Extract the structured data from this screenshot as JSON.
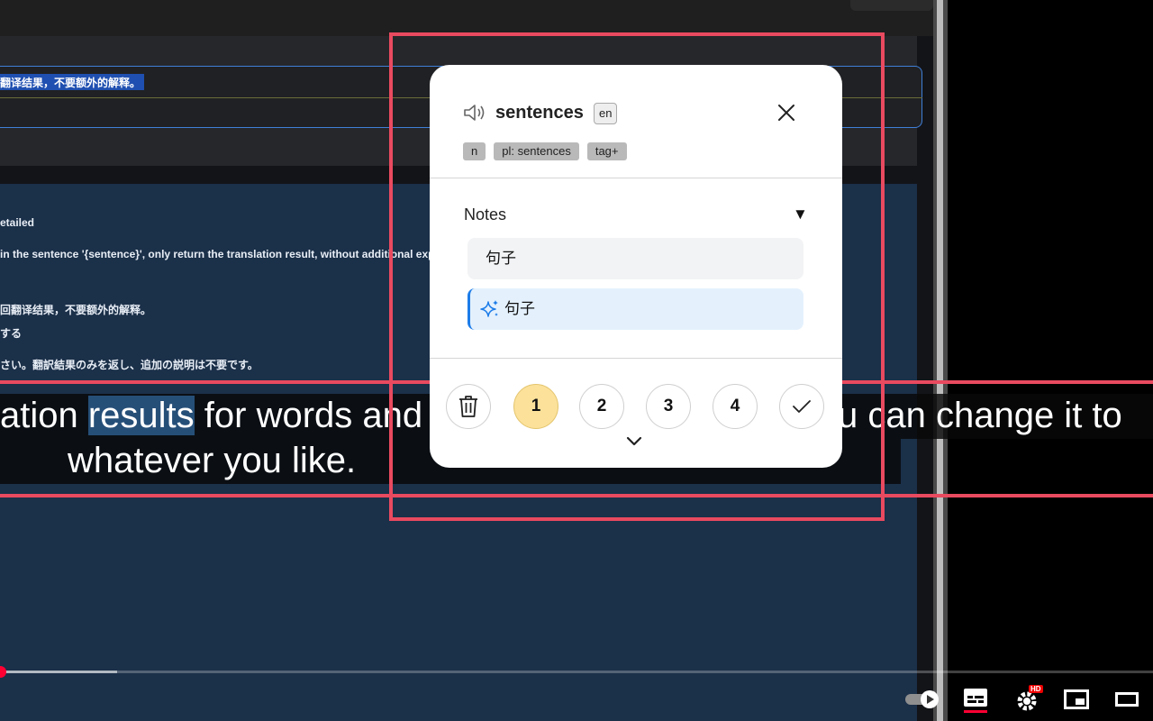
{
  "background": {
    "highlighted_prompt": "翻译结果，不要额外的解释。",
    "panel_lines": [
      "etailed",
      "in the sentence '{sentence}', only return the translation result, without additional exp",
      "回翻译结果，不要额外的解释。",
      "する",
      "さい。翻訳結果のみを返し、追加の説明は不要です。"
    ]
  },
  "captions": {
    "line1_prefix": "ation ",
    "line1_highlight": "results",
    "line1_middle": " for words and",
    "line1_right": "u can change it to",
    "line2": "whatever you like."
  },
  "popup": {
    "word": "sentences",
    "language": "en",
    "tags": [
      "n",
      "pl: sentences",
      "tag+"
    ],
    "notes_label": "Notes",
    "notes_toggle": "▼",
    "notes": [
      {
        "text": "句子",
        "type": "manual"
      },
      {
        "text": "句子",
        "type": "ai"
      }
    ],
    "ratings": [
      "1",
      "2",
      "3",
      "4"
    ],
    "active_rating": "1",
    "icons": {
      "speaker": "speaker-icon",
      "close": "close-icon",
      "delete": "trash-icon",
      "confirm": "checkmark-icon",
      "expand": "chevron-down-icon",
      "ai": "sparkle-icon"
    }
  },
  "player": {
    "hd_badge": "HD"
  },
  "colors": {
    "accent_red": "#e94a5f",
    "rating_active": "#fbe19a",
    "ai_note_bg": "#e4f1fd",
    "ai_note_border": "#1c7ce8"
  }
}
